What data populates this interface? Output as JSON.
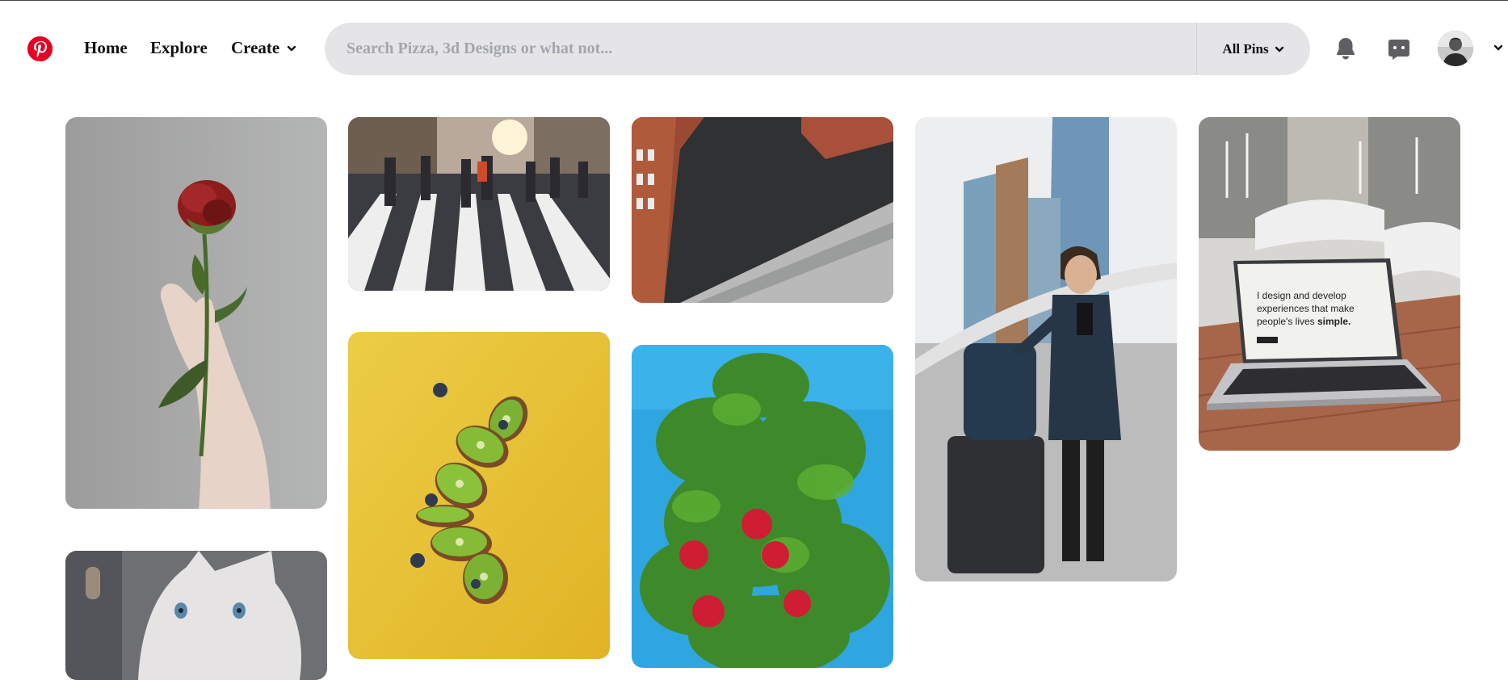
{
  "header": {
    "nav": {
      "home": "Home",
      "explore": "Explore",
      "create": "Create"
    },
    "search": {
      "placeholder": "Search Pizza, 3d Designs or what not...",
      "filter_label": "All Pins"
    }
  },
  "pins": [
    {
      "id": "rose",
      "alt": "Hand holding red rose"
    },
    {
      "id": "crosswalk",
      "alt": "Pedestrians on zebra crossing"
    },
    {
      "id": "rooftops",
      "alt": "Aerial rooftop view"
    },
    {
      "id": "traveler",
      "alt": "Man with luggage near skyscrapers"
    },
    {
      "id": "laptop",
      "alt": "Laptop on wooden table",
      "screen_text": "I design and develop experiences that make people's lives simple."
    },
    {
      "id": "kiwi",
      "alt": "Kiwi slices on yellow background"
    },
    {
      "id": "apples",
      "alt": "Apple tree branch against blue sky"
    },
    {
      "id": "cat",
      "alt": "White kitten with blue eyes"
    }
  ],
  "colors": {
    "brand": "#e60023",
    "search_bg": "#e5e5e8",
    "icon": "#5f5f63"
  }
}
